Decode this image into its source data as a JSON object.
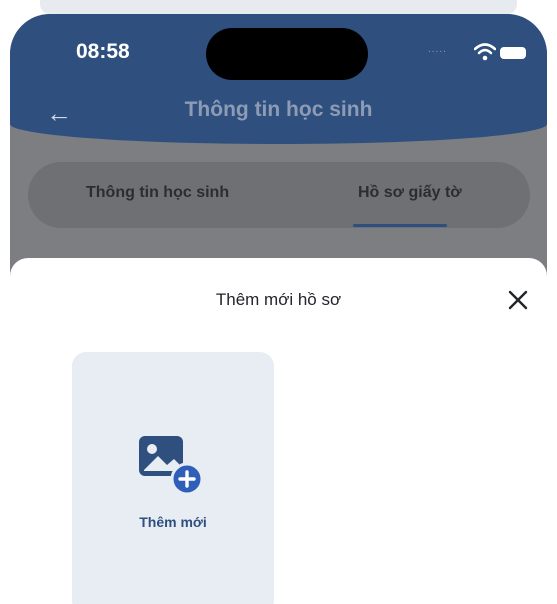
{
  "status_bar": {
    "time": "08:58",
    "dots": "....."
  },
  "header": {
    "title": "Thông tin học sinh",
    "back_icon": "arrow-left-icon"
  },
  "tabs": [
    {
      "label": "Thông tin học sinh",
      "selected": false
    },
    {
      "label": "Hồ sơ giấy tờ",
      "selected": true
    }
  ],
  "sheet": {
    "title": "Thêm mới hồ sơ",
    "close_icon": "close-icon",
    "add_card": {
      "label": "Thêm mới",
      "icon": "image-add-icon"
    }
  },
  "colors": {
    "primary": "#2f4f7e",
    "overlay": "#7c7e82",
    "card_bg": "#e8edf4",
    "plus_circle": "#2f5fb8"
  }
}
